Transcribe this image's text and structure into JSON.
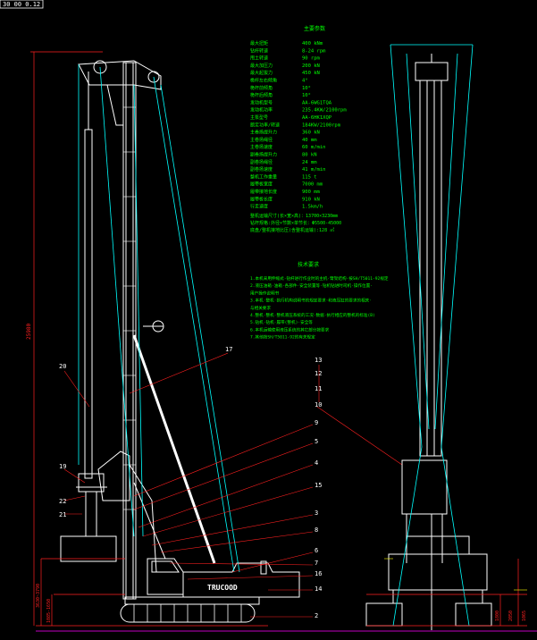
{
  "title_tab": "30 00 0.12",
  "spec_title": "主要参数",
  "specs": [
    {
      "label": "最大扭矩",
      "value": "400 kNm"
    },
    {
      "label": "钻杆转速",
      "value": "8-24 rpm"
    },
    {
      "label": "甩土转速",
      "value": "90 rpm"
    },
    {
      "label": "最大加压力",
      "value": "200 kN"
    },
    {
      "label": "最大起拔力",
      "value": "450 kN"
    },
    {
      "label": "桅杆左右倾角",
      "value": "4°"
    },
    {
      "label": "桅杆前倾角",
      "value": "10°"
    },
    {
      "label": "桅杆后倾角",
      "value": "10°"
    },
    {
      "label": "发动机型号",
      "value": "AA-6WG1TQA"
    },
    {
      "label": "发动机功率",
      "value": "235.4KW/2100rpm"
    },
    {
      "label": "主泵型号",
      "value": "AA-6HK1XQP"
    },
    {
      "label": "额定功率/转速",
      "value": "184KW/2100rpm"
    },
    {
      "label": "主卷扬提升力",
      "value": "360 kN"
    },
    {
      "label": "主卷扬绳径",
      "value": "40 mm"
    },
    {
      "label": "主卷扬速度",
      "value": "60 m/min"
    },
    {
      "label": "副卷扬提升力",
      "value": "80 kN"
    },
    {
      "label": "副卷扬绳径",
      "value": "24 mm"
    },
    {
      "label": "副卷扬速度",
      "value": "41 m/min"
    },
    {
      "label": "整机工作重量",
      "value": "115 t"
    },
    {
      "label": "履带板宽度",
      "value": "7000 mm"
    },
    {
      "label": "履带接地长度",
      "value": "900 mm"
    },
    {
      "label": "履带板长度",
      "value": "910 kN"
    },
    {
      "label": "行走速度",
      "value": "1.5km/h"
    }
  ],
  "spec_extra": [
    "整机运输尺寸(长×宽×高)：13700×3230mm",
    "钻杆规格:外径×节数×单节长：Φ5500-45000",
    "底盘/整机接地比压(含整机运输):128 ㎡"
  ],
  "tech_title": "技术要求",
  "tech_notes": [
    "1.本机采用伸缩式·钻杆进行作业时的主机·臂架结构·按SH/T5011-92规定",
    "2.液压油箱·油箱·各部件·安全装置等·钻机钻进时司机·操作位置·",
    "   用户操作说明书",
    "3.本机·整机·执行机构说明书的规定要求·和液压缸的要求的相关·",
    "   与相关要求",
    "4.整机·整机·整机液压系统的工况·数据·执行相应的整机的标准(B)",
    "5.钻机·钻机·履带(整机)·安全等",
    "6.本机运输使用液压系统的其它部分按要求",
    "7.其他按SH/T5011-92的有关规定"
  ],
  "callouts": [
    "20",
    "17",
    "19",
    "22",
    "21",
    "9",
    "5",
    "4",
    "15",
    "3",
    "8",
    "6",
    "7",
    "16",
    "14",
    "2",
    "13",
    "12",
    "11",
    "10"
  ],
  "dims": {
    "height_total": "25980",
    "low1": "3630~3790",
    "low2": "1085-1650",
    "right1": "1800",
    "right2": "2050",
    "right3": "1065"
  },
  "brand": "TRUCOOD",
  "colors": {
    "bg": "#000000",
    "line": "#ffffff",
    "cyan": "#00ffff",
    "green": "#00ff00",
    "red": "#ff2020",
    "magenta": "#ff00ff",
    "yellow": "#ffff00"
  }
}
